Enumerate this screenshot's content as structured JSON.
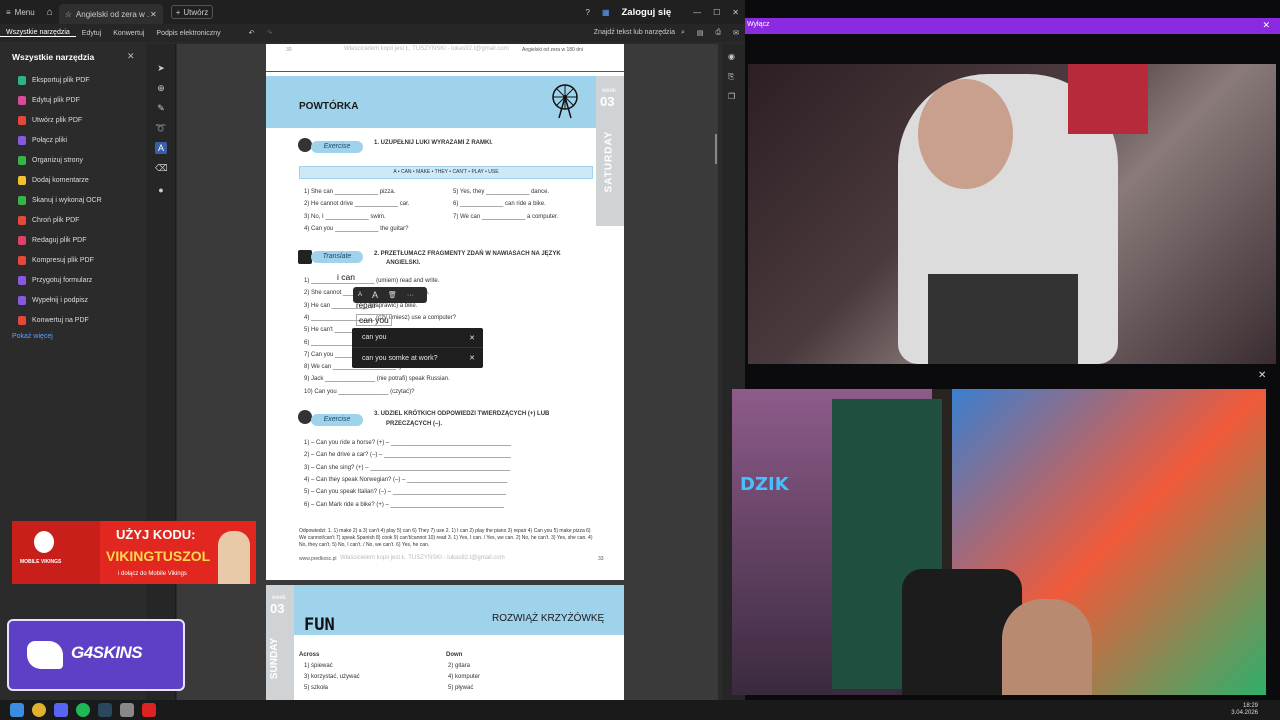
{
  "window": {
    "menu_label": "Menu",
    "doc_tab": "Angielski od zera w ...",
    "new_tab": "Utwórz",
    "sign_in": "Zaloguj się"
  },
  "menubar": {
    "items": [
      "Wszystkie narzędzia",
      "Edytuj",
      "Konwertuj",
      "Podpis elektroniczny"
    ],
    "search": "Znajdź tekst lub narzędzia"
  },
  "left_panel": {
    "title": "Wszystkie narzędzia",
    "tools": [
      {
        "label": "Eksportuj plik PDF",
        "color": "#2fb28a"
      },
      {
        "label": "Edytuj plik PDF",
        "color": "#d84a9a"
      },
      {
        "label": "Utwórz plik PDF",
        "color": "#e4483c"
      },
      {
        "label": "Połącz pliki",
        "color": "#8a58e0"
      },
      {
        "label": "Organizuj strony",
        "color": "#37b34a"
      },
      {
        "label": "Dodaj komentarze",
        "color": "#f2c12e"
      },
      {
        "label": "Skanuj i wykonaj OCR",
        "color": "#37b34a"
      },
      {
        "label": "Chroń plik PDF",
        "color": "#e4483c"
      },
      {
        "label": "Redaguj plik PDF",
        "color": "#e0406a"
      },
      {
        "label": "Kompresuj plik PDF",
        "color": "#e4483c"
      },
      {
        "label": "Przygotuj formularz",
        "color": "#8a58e0"
      },
      {
        "label": "Wypełnij i podpisz",
        "color": "#8a58e0"
      },
      {
        "label": "Konwertuj na PDF",
        "color": "#e4483c"
      }
    ],
    "more": "Pokaż więcej"
  },
  "page1": {
    "header_left": "30",
    "header_mid": "Właścicielem kopii jest Ł. TUSZYŃSKI - lukas92.t@gmail.com",
    "header_right": "Angielski od zera w 180 dni",
    "title": "POWTÓRKA",
    "week_label": "week",
    "week_num": "03",
    "day": "SATURDAY",
    "ex1_pill": "Exercise",
    "ex1_title": "1.  UZUPEŁNIJ LUKI WYRAZAMI Z RAMKI.",
    "wordbox": "A • CAN • MAKE • THEY • CAN'T • PLAY • USE",
    "ex1_rows": [
      [
        "1)  She can _____________ pizza.",
        "5)  Yes, they _____________ dance."
      ],
      [
        "2)  He cannot drive _____________ car.",
        "6)  _____________ can ride a bike."
      ],
      [
        "3)  No, I _____________ swim.",
        "7)  We can _____________ a computer."
      ],
      [
        "4)  Can you _____________ the guitar?",
        ""
      ]
    ],
    "ex2_pill": "Translate",
    "ex2_title_1": "2.  PRZETŁUMACZ FRAGMENTY ZDAŃ W NAWIASACH NA JĘZYK",
    "ex2_title_2": "ANGIELSKI.",
    "ex2_rows": [
      "1)  ___________________ (umiem) read and write.",
      "2)  She cannot ___________ (grać na pianinie).",
      "3)  He can ___________ (naprawić) a bike.",
      "4)  ___________________ (czy umiesz) use a computer?",
      "5)  He can't ______________________________.",
      "6)  ___________________________________ car.",
      "7)  Can you ______________________ (opisku)?",
      "8)  We can ___________________ gotować.",
      "9)  Jack _______________ (nie potrafi) speak Russian.",
      "10) Can you _______________ (czytać)?"
    ],
    "hand_1": "i can",
    "hand_2": "repair",
    "hand_3": "can you",
    "ex3_pill": "Exercise",
    "ex3_title_1": "3.  UDZIEL KRÓTKICH ODPOWIEDZI TWIERDZĄCYCH (+) LUB",
    "ex3_title_2": "PRZECZĄCYCH (–).",
    "ex3_rows": [
      "1)  – Can you ride a horse? (+) – ____________________________________",
      "2)  – Can he drive a car? (–) – ______________________________________",
      "3)  – Can she sing? (+) – __________________________________________",
      "4)  – Can they speak Norwegian? (–) – ______________________________",
      "5)  – Can you speak Italian? (–) – __________________________________",
      "6)  – Can Mark ride a bike? (+) – __________________________________"
    ],
    "answers": "Odpowiedzi: 1. 1) make 2) a 3) can't 4) play 5) can 6) They 7) use 2. 1) I can 2) play the piano 3) repair 4) Can you 5) make pizza 6) We cannot/can't 7) speak Spanish 8) cook 9) can't/cannot 10) read 3. 1) Yes, I can. / Yes, we can. 2) No, he can't. 3) Yes, she can. 4) No, they can't. 5) No, I can't. / No, we can't. 6) Yes, he can.",
    "footer_left": "www.predkosc.pl",
    "footer_mid": "Właścicielem kopii jest Ł. TUSZYŃSKI - lukas92.t@gmail.com",
    "footer_right": "33"
  },
  "popup": {
    "tools": [
      "A",
      "A",
      "🗑",
      "···"
    ],
    "suggestions": [
      "can you",
      "can you somke at work?"
    ]
  },
  "page2": {
    "week_label": "week",
    "week_num": "03",
    "day": "SUNDAY",
    "fun": "FUN",
    "title": "ROZWIĄŻ KRZYŻÓWKĘ",
    "across_label": "Across",
    "down_label": "Down",
    "across": [
      "1) śpiewać",
      "3) korzystać, używać",
      "5) szkoła"
    ],
    "down": [
      "2) gitara",
      "4) komputer",
      "5) pływać"
    ]
  },
  "stream": {
    "promo_code_label": "UŻYJ KODU:",
    "promo_code": "VIKINGTUSZOL",
    "promo_sub": "i dołącz do Mobile Vikings",
    "promo_brand": "MOBILE VIKINGS",
    "g4_brand": "G4SKINS",
    "neon_sign": "DZIK",
    "top_banner": "Wyłącz"
  },
  "taskbar": {
    "time": "18:29",
    "date": "3.04.2026"
  }
}
